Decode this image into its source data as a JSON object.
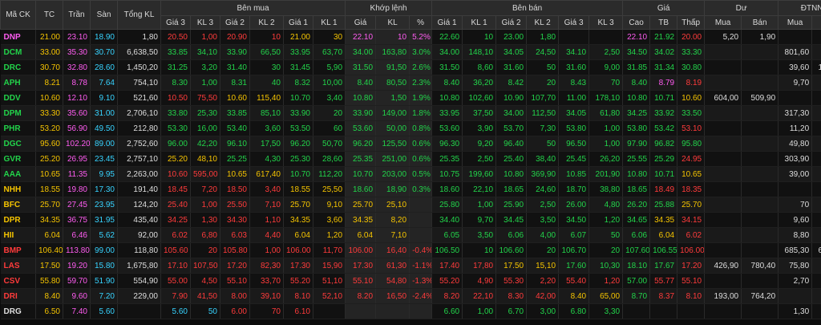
{
  "header": {
    "groups": {
      "symbol": "Mã CK",
      "ref": "TC",
      "ceil": "Trần",
      "floor": "Sàn",
      "total": "Tổng KL",
      "buy": "Bên mua",
      "match": "Khớp lệnh",
      "sell": "Bên bán",
      "price": "Giá",
      "remain": "Dư",
      "foreign": "ĐTNN"
    },
    "sub": [
      "Giá 3",
      "KL 3",
      "Giá 2",
      "KL 2",
      "Giá 1",
      "KL 1",
      "Giá",
      "KL",
      "%",
      "Giá 1",
      "KL 1",
      "Giá 2",
      "KL 2",
      "Giá 3",
      "KL 3",
      "Cao",
      "TB",
      "Thấp",
      "Mua",
      "Bán",
      "Mua",
      "Bán"
    ]
  },
  "rows": [
    {
      "c": [
        "DNP",
        "21.00",
        "23.10",
        "18.90",
        "1,80",
        "20.50",
        "1,00",
        "20.90",
        "10",
        "21.00",
        "30",
        "22.10",
        "10",
        "5.2%",
        "22.60",
        "10",
        "23.00",
        "1,80",
        "",
        "",
        "22.10",
        "21.92",
        "20.00",
        "5,20",
        "1,90",
        "",
        ""
      ],
      "s": [
        "ce",
        "tc",
        "tr",
        "sn",
        "wh",
        "dn",
        "dn",
        "dn",
        "dn",
        "ref",
        "ref",
        "ce",
        "ce",
        "ce",
        "up",
        "up",
        "up",
        "up",
        "",
        "",
        "ce",
        "up",
        "dn",
        "wh",
        "wh",
        "",
        ""
      ]
    },
    {
      "c": [
        "DCM",
        "33.00",
        "35.30",
        "30.70",
        "6,638,50",
        "33.85",
        "34,10",
        "33.90",
        "66,50",
        "33.95",
        "63,70",
        "34.00",
        "163,80",
        "3.0%",
        "34.00",
        "148,10",
        "34.05",
        "24,50",
        "34.10",
        "2,50",
        "34.50",
        "34.02",
        "33.30",
        "",
        "",
        "801,60",
        "90,53"
      ],
      "s": [
        "up",
        "tc",
        "tr",
        "sn",
        "wh",
        "up",
        "up",
        "up",
        "up",
        "up",
        "up",
        "up",
        "up",
        "up",
        "up",
        "up",
        "up",
        "up",
        "up",
        "up",
        "up",
        "up",
        "up",
        "",
        "",
        "wh",
        "wh"
      ]
    },
    {
      "c": [
        "DRC",
        "30.70",
        "32.80",
        "28.60",
        "1,450,20",
        "31.25",
        "3,20",
        "31.40",
        "30",
        "31.45",
        "5,90",
        "31.50",
        "91,50",
        "2.6%",
        "31.50",
        "8,60",
        "31.60",
        "50",
        "31.60",
        "9,00",
        "31.85",
        "31.34",
        "30.80",
        "",
        "",
        "39,60",
        "126,30"
      ],
      "s": [
        "up",
        "tc",
        "tr",
        "sn",
        "wh",
        "up",
        "up",
        "up",
        "up",
        "up",
        "up",
        "up",
        "up",
        "up",
        "up",
        "up",
        "up",
        "up",
        "up",
        "up",
        "up",
        "up",
        "up",
        "",
        "",
        "wh",
        "wh"
      ]
    },
    {
      "c": [
        "APH",
        "8.21",
        "8.78",
        "7.64",
        "754,10",
        "8.30",
        "1,00",
        "8.31",
        "40",
        "8.32",
        "10,00",
        "8.40",
        "80,50",
        "2.3%",
        "8.40",
        "36,20",
        "8.42",
        "20",
        "8.43",
        "70",
        "8.40",
        "8.79",
        "8.19",
        "",
        "",
        "9,70",
        "90"
      ],
      "s": [
        "up",
        "tc",
        "tr",
        "sn",
        "wh",
        "up",
        "up",
        "up",
        "up",
        "up",
        "up",
        "up",
        "up",
        "up",
        "up",
        "up",
        "up",
        "up",
        "up",
        "up",
        "up",
        "ce",
        "dn",
        "",
        "",
        "wh",
        "wh"
      ]
    },
    {
      "c": [
        "DDV",
        "10.60",
        "12.10",
        "9.10",
        "521,60",
        "10.50",
        "75,50",
        "10.60",
        "115,40",
        "10.70",
        "3,40",
        "10.80",
        "1,50",
        "1.9%",
        "10.80",
        "102,60",
        "10.90",
        "107,70",
        "11.00",
        "178,10",
        "10.80",
        "10.71",
        "10.60",
        "604,00",
        "509,90",
        "",
        ""
      ],
      "s": [
        "up",
        "tc",
        "tr",
        "sn",
        "wh",
        "dn",
        "dn",
        "ref",
        "ref",
        "up",
        "up",
        "up",
        "up",
        "up",
        "up",
        "up",
        "up",
        "up",
        "up",
        "up",
        "up",
        "up",
        "ref",
        "wh",
        "wh",
        "",
        ""
      ]
    },
    {
      "c": [
        "DPM",
        "33.30",
        "35.60",
        "31.00",
        "2,706,10",
        "33.80",
        "25,30",
        "33.85",
        "85,10",
        "33.90",
        "20",
        "33.90",
        "149,00",
        "1.8%",
        "33.95",
        "37,50",
        "34.00",
        "112,50",
        "34.05",
        "61,80",
        "34.25",
        "33.92",
        "33.50",
        "",
        "",
        "317,30",
        "14,50"
      ],
      "s": [
        "up",
        "tc",
        "tr",
        "sn",
        "wh",
        "up",
        "up",
        "up",
        "up",
        "up",
        "up",
        "up",
        "up",
        "up",
        "up",
        "up",
        "up",
        "up",
        "up",
        "up",
        "up",
        "up",
        "up",
        "",
        "",
        "wh",
        "wh"
      ]
    },
    {
      "c": [
        "PHR",
        "53.20",
        "56.90",
        "49.50",
        "212,80",
        "53.30",
        "16,00",
        "53.40",
        "3,60",
        "53.50",
        "60",
        "53.60",
        "50,00",
        "0.8%",
        "53.60",
        "3,90",
        "53.70",
        "7,30",
        "53.80",
        "1,00",
        "53.80",
        "53.42",
        "53.10",
        "",
        "",
        "11,20",
        "2,10"
      ],
      "s": [
        "up",
        "tc",
        "tr",
        "sn",
        "wh",
        "up",
        "up",
        "up",
        "up",
        "up",
        "up",
        "up",
        "up",
        "up",
        "up",
        "up",
        "up",
        "up",
        "up",
        "up",
        "up",
        "up",
        "dn",
        "",
        "",
        "wh",
        "wh"
      ]
    },
    {
      "c": [
        "DGC",
        "95.60",
        "102.20",
        "89.00",
        "2,752,60",
        "96.00",
        "42,20",
        "96.10",
        "17,50",
        "96.20",
        "50,70",
        "96.20",
        "125,50",
        "0.6%",
        "96.30",
        "9,20",
        "96.40",
        "50",
        "96.50",
        "1,00",
        "97.90",
        "96.82",
        "95.80",
        "",
        "",
        "49,80",
        "9,85"
      ],
      "s": [
        "up",
        "tc",
        "tr",
        "sn",
        "wh",
        "up",
        "up",
        "up",
        "up",
        "up",
        "up",
        "up",
        "up",
        "up",
        "up",
        "up",
        "up",
        "up",
        "up",
        "up",
        "up",
        "up",
        "up",
        "",
        "",
        "wh",
        "wh"
      ]
    },
    {
      "c": [
        "GVR",
        "25.20",
        "26.95",
        "23.45",
        "2,757,10",
        "25.20",
        "48,10",
        "25.25",
        "4,30",
        "25.30",
        "28,60",
        "25.35",
        "251,00",
        "0.6%",
        "25.35",
        "2,50",
        "25.40",
        "38,40",
        "25.45",
        "26,20",
        "25.55",
        "25.29",
        "24.95",
        "",
        "",
        "303,90",
        "92,00"
      ],
      "s": [
        "up",
        "tc",
        "tr",
        "sn",
        "wh",
        "ref",
        "ref",
        "up",
        "up",
        "up",
        "up",
        "up",
        "up",
        "up",
        "up",
        "up",
        "up",
        "up",
        "up",
        "up",
        "up",
        "up",
        "dn",
        "",
        "",
        "wh",
        "wh"
      ]
    },
    {
      "c": [
        "AAA",
        "10.65",
        "11.35",
        "9.95",
        "2,263,00",
        "10.60",
        "595,00",
        "10.65",
        "617,40",
        "10.70",
        "112,20",
        "10.70",
        "203,00",
        "0.5%",
        "10.75",
        "199,60",
        "10.80",
        "369,90",
        "10.85",
        "201,90",
        "10.80",
        "10.71",
        "10.65",
        "",
        "",
        "39,00",
        "10,44"
      ],
      "s": [
        "up",
        "tc",
        "tr",
        "sn",
        "wh",
        "dn",
        "dn",
        "ref",
        "ref",
        "up",
        "up",
        "up",
        "up",
        "up",
        "up",
        "up",
        "up",
        "up",
        "up",
        "up",
        "up",
        "up",
        "ref",
        "",
        "",
        "wh",
        "wh"
      ]
    },
    {
      "c": [
        "NHH",
        "18.55",
        "19.80",
        "17.30",
        "191,40",
        "18.45",
        "7,20",
        "18.50",
        "3,40",
        "18.55",
        "25,50",
        "18.60",
        "18,90",
        "0.3%",
        "18.60",
        "22,10",
        "18.65",
        "24,60",
        "18.70",
        "38,80",
        "18.65",
        "18.49",
        "18.35",
        "",
        "",
        "",
        ""
      ],
      "s": [
        "ref",
        "tc",
        "tr",
        "sn",
        "wh",
        "dn",
        "dn",
        "dn",
        "dn",
        "ref",
        "ref",
        "up",
        "up",
        "up",
        "up",
        "up",
        "up",
        "up",
        "up",
        "up",
        "up",
        "dn",
        "dn",
        "",
        "",
        "",
        ""
      ]
    },
    {
      "c": [
        "BFC",
        "25.70",
        "27.45",
        "23.95",
        "124,20",
        "25.40",
        "1,00",
        "25.50",
        "7,10",
        "25.70",
        "9,10",
        "25.70",
        "25,10",
        "",
        "25.80",
        "1,00",
        "25.90",
        "2,50",
        "26.00",
        "4,80",
        "26.20",
        "25.88",
        "25.70",
        "",
        "",
        "70",
        "12,20"
      ],
      "s": [
        "ref",
        "tc",
        "tr",
        "sn",
        "wh",
        "dn",
        "dn",
        "dn",
        "dn",
        "ref",
        "ref",
        "ref",
        "ref",
        "",
        "up",
        "up",
        "up",
        "up",
        "up",
        "up",
        "up",
        "up",
        "ref",
        "",
        "",
        "wh",
        "wh"
      ]
    },
    {
      "c": [
        "DPR",
        "34.35",
        "36.75",
        "31.95",
        "435,40",
        "34.25",
        "1,30",
        "34.30",
        "1,10",
        "34.35",
        "3,60",
        "34.35",
        "8,20",
        "",
        "34.40",
        "9,70",
        "34.45",
        "3,50",
        "34.50",
        "1,20",
        "34.65",
        "34.35",
        "34.15",
        "",
        "",
        "9,60",
        "4,10"
      ],
      "s": [
        "ref",
        "tc",
        "tr",
        "sn",
        "wh",
        "dn",
        "dn",
        "dn",
        "dn",
        "ref",
        "ref",
        "ref",
        "ref",
        "",
        "up",
        "up",
        "up",
        "up",
        "up",
        "up",
        "up",
        "ref",
        "dn",
        "",
        "",
        "wh",
        "wh"
      ]
    },
    {
      "c": [
        "HII",
        "6.04",
        "6.46",
        "5.62",
        "92,00",
        "6.02",
        "6,80",
        "6.03",
        "4,40",
        "6.04",
        "1,20",
        "6.04",
        "7,10",
        "",
        "6.05",
        "3,50",
        "6.06",
        "4,00",
        "6.07",
        "50",
        "6.06",
        "6.04",
        "6.02",
        "",
        "",
        "8,80",
        ""
      ],
      "s": [
        "ref",
        "tc",
        "tr",
        "sn",
        "wh",
        "dn",
        "dn",
        "dn",
        "dn",
        "ref",
        "ref",
        "ref",
        "ref",
        "",
        "up",
        "up",
        "up",
        "up",
        "up",
        "up",
        "up",
        "ref",
        "dn",
        "",
        "",
        "wh",
        ""
      ]
    },
    {
      "c": [
        "BMP",
        "106.40",
        "113.80",
        "99.00",
        "118,80",
        "105.60",
        "20",
        "105.80",
        "1,00",
        "106.00",
        "11,70",
        "106.00",
        "16,40",
        "-0.4%",
        "106.50",
        "10",
        "106.60",
        "20",
        "106.70",
        "20",
        "107.60",
        "106.55",
        "106.00",
        "",
        "",
        "685,30",
        "687,90"
      ],
      "s": [
        "dn",
        "tc",
        "tr",
        "sn",
        "wh",
        "dn",
        "dn",
        "dn",
        "dn",
        "dn",
        "dn",
        "dn",
        "dn",
        "dn",
        "up",
        "up",
        "up",
        "up",
        "up",
        "up",
        "up",
        "up",
        "dn",
        "",
        "",
        "wh",
        "wh"
      ]
    },
    {
      "c": [
        "LAS",
        "17.50",
        "19.20",
        "15.80",
        "1,675,80",
        "17.10",
        "107,50",
        "17.20",
        "82,30",
        "17.30",
        "15,90",
        "17.30",
        "61,30",
        "-1.1%",
        "17.40",
        "17,80",
        "17.50",
        "15,10",
        "17.60",
        "10,30",
        "18.10",
        "17.67",
        "17.20",
        "426,90",
        "780,40",
        "75,80",
        ""
      ],
      "s": [
        "dn",
        "tc",
        "tr",
        "sn",
        "wh",
        "dn",
        "dn",
        "dn",
        "dn",
        "dn",
        "dn",
        "dn",
        "dn",
        "dn",
        "dn",
        "dn",
        "ref",
        "ref",
        "up",
        "up",
        "up",
        "up",
        "dn",
        "wh",
        "wh",
        "wh",
        ""
      ]
    },
    {
      "c": [
        "CSV",
        "55.80",
        "59.70",
        "51.90",
        "554,90",
        "55.00",
        "4,50",
        "55.10",
        "33,70",
        "55.20",
        "51,10",
        "55.10",
        "54,80",
        "-1.3%",
        "55.20",
        "4,90",
        "55.30",
        "2,20",
        "55.40",
        "1,20",
        "57.00",
        "55.77",
        "55.10",
        "",
        "",
        "2,70",
        "87,70"
      ],
      "s": [
        "dn",
        "tc",
        "tr",
        "sn",
        "wh",
        "dn",
        "dn",
        "dn",
        "dn",
        "dn",
        "dn",
        "dn",
        "dn",
        "dn",
        "dn",
        "dn",
        "dn",
        "dn",
        "dn",
        "dn",
        "up",
        "dn",
        "dn",
        "",
        "",
        "wh",
        "wh"
      ]
    },
    {
      "c": [
        "DRI",
        "8.40",
        "9.60",
        "7.20",
        "229,00",
        "7.90",
        "41,50",
        "8.00",
        "39,10",
        "8.10",
        "52,10",
        "8.20",
        "16,50",
        "-2.4%",
        "8.20",
        "22,10",
        "8.30",
        "42,00",
        "8.40",
        "65,00",
        "8.70",
        "8.37",
        "8.10",
        "193,00",
        "764,20",
        "",
        ""
      ],
      "s": [
        "dn",
        "tc",
        "tr",
        "sn",
        "wh",
        "dn",
        "dn",
        "dn",
        "dn",
        "dn",
        "dn",
        "dn",
        "dn",
        "dn",
        "dn",
        "dn",
        "dn",
        "dn",
        "ref",
        "ref",
        "up",
        "dn",
        "dn",
        "wh",
        "wh",
        "",
        ""
      ]
    },
    {
      "c": [
        "DRG",
        "6.50",
        "7.40",
        "5.60",
        "",
        "5.60",
        "50",
        "6.00",
        "70",
        "6.10",
        "",
        "",
        "",
        "",
        "6.60",
        "1,00",
        "6.70",
        "3,00",
        "6.80",
        "3,30",
        "",
        "",
        "",
        "",
        "",
        "1,30",
        "30,50"
      ],
      "s": [
        "wh",
        "tc",
        "tr",
        "sn",
        "wh",
        "fl",
        "fl",
        "dn",
        "dn",
        "dn",
        "",
        "",
        "",
        "",
        "up",
        "up",
        "up",
        "up",
        "up",
        "up",
        "",
        "",
        "",
        "",
        "",
        "wh",
        "wh"
      ]
    }
  ]
}
